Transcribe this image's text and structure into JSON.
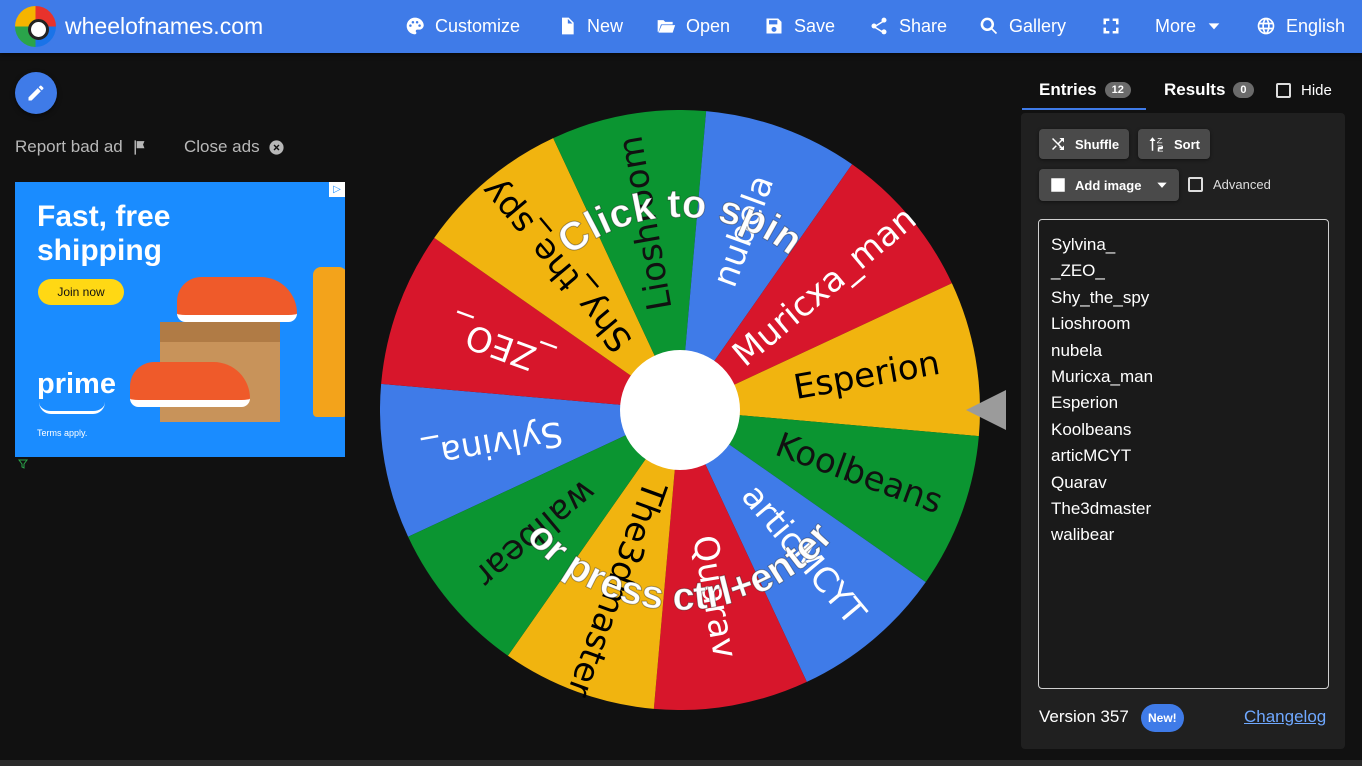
{
  "header": {
    "site_title": "wheelofnames.com",
    "nav": [
      {
        "label": "Customize",
        "icon": "palette-icon"
      },
      {
        "label": "New",
        "icon": "new-file-icon"
      },
      {
        "label": "Open",
        "icon": "folder-open-icon"
      },
      {
        "label": "Save",
        "icon": "save-icon"
      },
      {
        "label": "Share",
        "icon": "share-icon"
      },
      {
        "label": "Gallery",
        "icon": "search-icon"
      },
      {
        "label": "",
        "icon": "fullscreen-icon"
      },
      {
        "label": "More",
        "icon": "chevron-down-icon"
      },
      {
        "label": "English",
        "icon": "globe-icon"
      }
    ]
  },
  "ads": {
    "report_label": "Report bad ad",
    "close_label": "Close ads",
    "headline": "Fast, free shipping",
    "cta": "Join now",
    "brand": "prime",
    "terms": "Terms apply."
  },
  "wheel": {
    "center_color": "#ffffff",
    "overlay_line1": "Click to spin",
    "overlay_line2": "or press ctrl+enter",
    "segments": [
      {
        "label": "Sylvina_",
        "color": "#3f7be8"
      },
      {
        "label": "_ZEO_",
        "color": "#d7162b"
      },
      {
        "label": "Shy_the_spy",
        "color": "#f1b40f"
      },
      {
        "label": "Lioshroom",
        "color": "#0b9531"
      },
      {
        "label": "nubela",
        "color": "#3f7be8"
      },
      {
        "label": "Muricxa_man",
        "color": "#d7162b"
      },
      {
        "label": "Esperion",
        "color": "#f1b40f"
      },
      {
        "label": "Koolbeans",
        "color": "#0b9531"
      },
      {
        "label": "articMCYT",
        "color": "#3f7be8"
      },
      {
        "label": "Quarav",
        "color": "#d7162b"
      },
      {
        "label": "The3dmaster",
        "color": "#f1b40f"
      },
      {
        "label": "walibear",
        "color": "#0b9531"
      }
    ]
  },
  "panel": {
    "tab_entries": "Entries",
    "entries_count": "12",
    "tab_results": "Results",
    "results_count": "0",
    "hide_label": "Hide",
    "shuffle_label": "Shuffle",
    "sort_label": "Sort",
    "add_image_label": "Add image",
    "advanced_label": "Advanced",
    "entries": [
      "Sylvina_",
      "_ZEO_",
      "Shy_the_spy",
      "Lioshroom",
      "nubela",
      "Muricxa_man",
      "Esperion",
      "Koolbeans",
      "articMCYT",
      "Quarav",
      "The3dmaster",
      "walibear"
    ],
    "version": "Version 357",
    "new_badge": "New!",
    "changelog": "Changelog"
  },
  "colors": {
    "accent": "#3f7be8",
    "background": "#111111"
  }
}
